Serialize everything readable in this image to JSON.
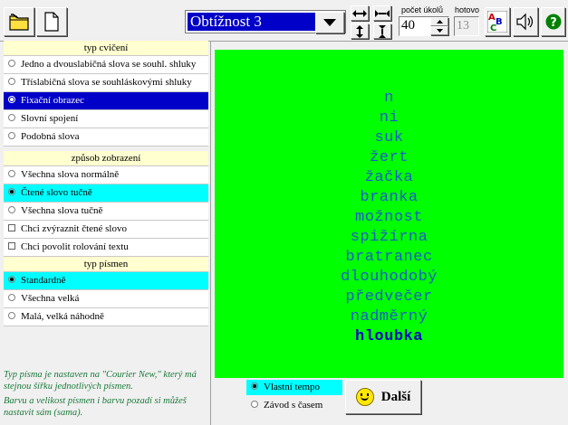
{
  "toolbar": {
    "difficulty_value": "Obtížnost 3",
    "task_count_label": "počet úkolů",
    "task_count_value": "40",
    "done_label": "hotovo",
    "done_value": "13"
  },
  "sections": {
    "exercise_type": {
      "header": "typ cvičení",
      "options": [
        {
          "label": "Jedno a dvouslabičná slova se souhl. shluky",
          "selected": false
        },
        {
          "label": "Tříslabičná slova se souhláskovými shluky",
          "selected": false
        },
        {
          "label": "Fixační obrazec",
          "selected": true
        },
        {
          "label": "Slovní spojení",
          "selected": false
        },
        {
          "label": "Podobná slova",
          "selected": false
        }
      ]
    },
    "display_mode": {
      "header": "způsob zobrazení",
      "options": [
        {
          "label": "Všechna slova normálně",
          "selected": false
        },
        {
          "label": "Čtené slovo tučně",
          "selected": true
        },
        {
          "label": "Všechna slova tučně",
          "selected": false
        }
      ],
      "checks": [
        {
          "label": "Chci zvýraznit čtené slovo",
          "checked": false
        },
        {
          "label": "Chci povolit rolování textu",
          "checked": false
        }
      ]
    },
    "font_type": {
      "header": "typ písmen",
      "options": [
        {
          "label": "Standardně",
          "selected": true
        },
        {
          "label": "Všechna velká",
          "selected": false
        },
        {
          "label": "Malá, velká náhodně",
          "selected": false
        }
      ]
    }
  },
  "info": {
    "line1": "Typ písma je nastaven na \"Courier New,\" který má stejnou šířku jednotlivých písmen.",
    "line2": "Barvu a velikost písmen i barvu pozadí si můžeš nastavit sám (sama)."
  },
  "words": [
    "n",
    "ni",
    "suk",
    "žert",
    "žačka",
    "branka",
    "možnost",
    "spižírna",
    "bratranec",
    "dlouhodobý",
    "předvečer",
    "nadměrný",
    "hloubka"
  ],
  "tempo": {
    "options": [
      {
        "label": "Vlastní tempo",
        "selected": true
      },
      {
        "label": "Závod s časem",
        "selected": false
      }
    ]
  },
  "next_button_label": "Další",
  "colors": {
    "reading_area_bg": "#00ff00",
    "word_color": "#1a5ac8",
    "highlight_blue": "#0000c8",
    "highlight_cyan": "#00ffff"
  }
}
